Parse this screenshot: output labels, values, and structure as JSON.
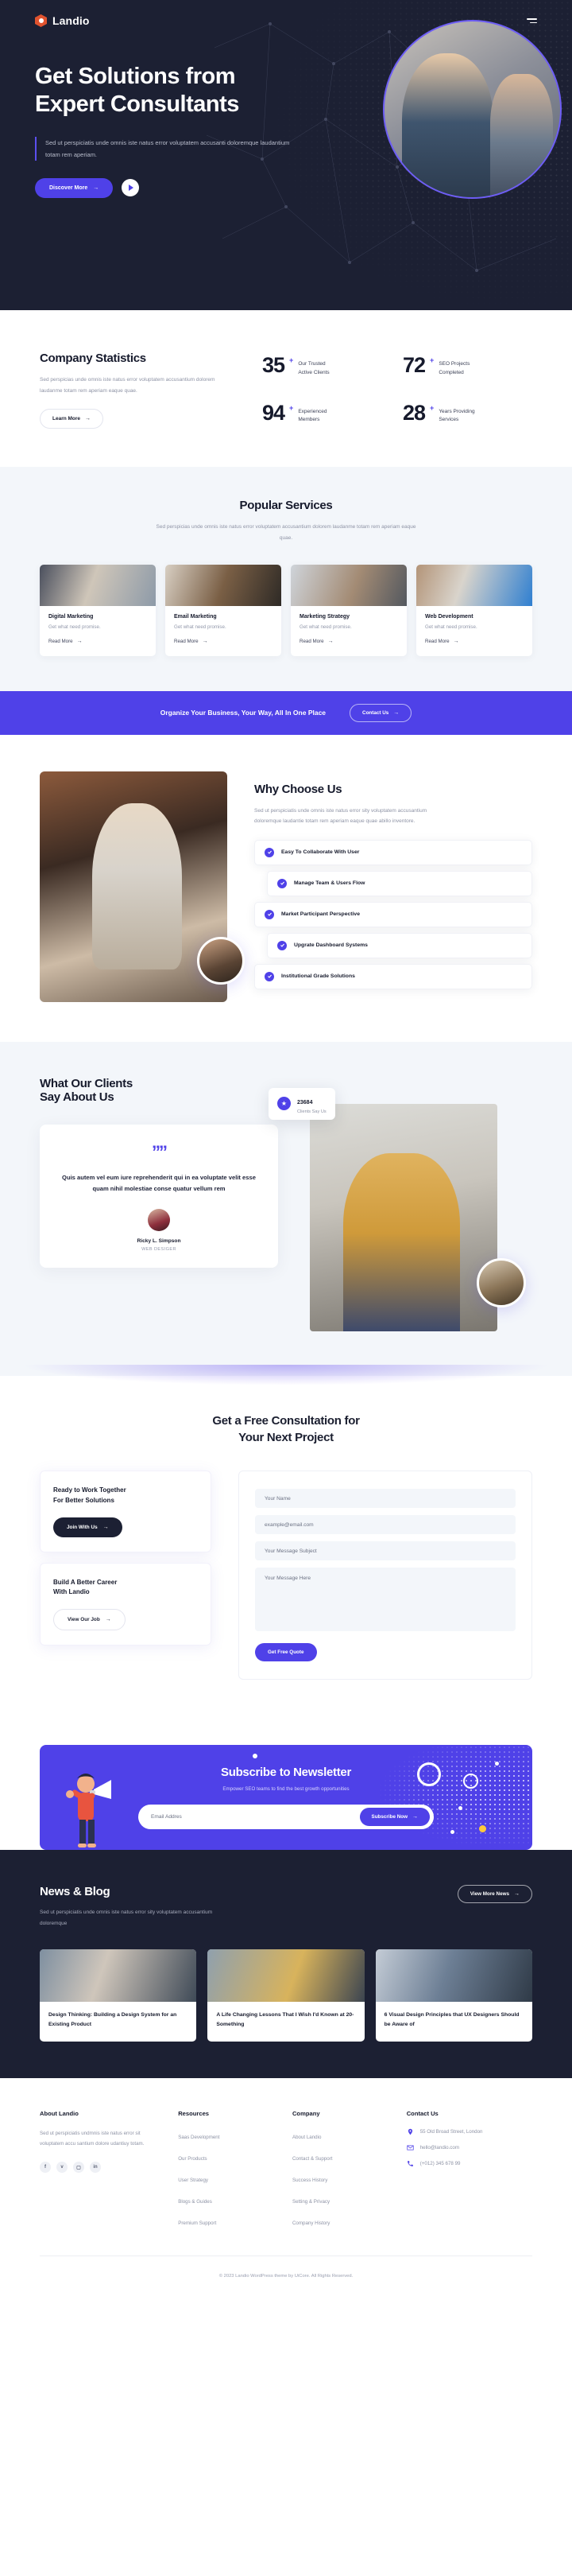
{
  "brand": {
    "name": "Landio",
    "logo_icon": "hexagon-logo-icon",
    "menu_icon": "menu-icon"
  },
  "hero": {
    "title_line1": "Get Solutions from",
    "title_line2": "Expert Consultants",
    "paragraph": "Sed ut perspiciatis unde omnis iste natus error voluptatem accusanti doloremque laudantium totam rem aperiam.",
    "primary_button": "Discover More",
    "play_icon": "play-icon"
  },
  "stats": {
    "title": "Company Statistics",
    "paragraph": "Sed perspicias unde omnis iste natus error voluptatem accusantium dolorem laudanme totam rem aperiam eaque quae.",
    "button": "Learn More",
    "items": [
      {
        "value": "35",
        "suffix": "+",
        "label_line1": "Our Trusted",
        "label_line2": "Active Clients"
      },
      {
        "value": "72",
        "suffix": "+",
        "label_line1": "SEO Projects",
        "label_line2": "Completed"
      },
      {
        "value": "94",
        "suffix": "+",
        "label_line1": "Experienced",
        "label_line2": "Members"
      },
      {
        "value": "28",
        "suffix": "+",
        "label_line1": "Years Providing",
        "label_line2": "Services"
      }
    ]
  },
  "services": {
    "title": "Popular Services",
    "paragraph": "Sed perspicias unde omnis iste natus error voluptatem accusantium dolorem laudanme totam rem aperiam eaque quae.",
    "cards": [
      {
        "title": "Digital Marketing",
        "desc": "Get what need promise.",
        "link": "Read More"
      },
      {
        "title": "Email Marketing",
        "desc": "Get what need promise.",
        "link": "Read More"
      },
      {
        "title": "Marketing Strategy",
        "desc": "Get what need promise.",
        "link": "Read More"
      },
      {
        "title": "Web Development",
        "desc": "Get what need promise.",
        "link": "Read More"
      }
    ]
  },
  "cta_bar": {
    "text": "Organize Your Business, Your Way, All In One Place",
    "button": "Contact Us"
  },
  "why": {
    "title": "Why Choose Us",
    "paragraph": "Sed ut perspiciatis unde omnis iste natus error sity voluptatem accusantium doloremque laudantie totam rem aperiam eaque quae abillo inventore.",
    "features": [
      "Easy To Collaborate With User",
      "Manage Team & Users Flow",
      "Market Participant Perspective",
      "Upgrate Dashboard Systems",
      "Institutional Grade Solutions"
    ]
  },
  "testimonials": {
    "title_line1": "What Our Clients",
    "title_line2": "Say About Us",
    "quote_icon": "quote-icon",
    "quote": "Quis autem vel eum iure reprehenderit qui in ea voluptate velit esse quam nihil molestiae conse quatur vellum rem",
    "author": "Ricky L. Simpson",
    "role": "WEB DESIGER",
    "chip": {
      "count": "23684",
      "label": "Clients Say Us",
      "icon": "star-badge-icon"
    }
  },
  "consult": {
    "title_line1": "Get a Free Consultation for",
    "title_line2": "Your Next Project",
    "box1": {
      "title_line1": "Ready to Work Together",
      "title_line2": "For Better Solutions",
      "button": "Join With Us"
    },
    "box2": {
      "title_line1": "Build A Better Career",
      "title_line2": "With Landio",
      "button": "View Our Job"
    },
    "form": {
      "name_placeholder": "Your Name",
      "email_placeholder": "example@email.com",
      "subject_placeholder": "Your Message Subject",
      "message_placeholder": "Your Message Here",
      "submit": "Get Free Quote"
    }
  },
  "newsletter": {
    "title": "Subscribe to Newsletter",
    "subtitle": "Empower SEO teams to find the best growth opportunities",
    "input_placeholder": "Email Addres",
    "button": "Subscribe Now"
  },
  "blog": {
    "title": "News & Blog",
    "paragraph": "Sed ut perspiciatis unde omnis iste natus error sity voluptatem accusantium doloremque",
    "button": "View More News",
    "posts": [
      {
        "title": "Design Thinking: Building a Design System for an Existing Product"
      },
      {
        "title": "A Life Changing Lessons That I Wish I'd Known at 20-Something"
      },
      {
        "title": "6 Visual Design Principles that UX Designers Should be Aware of"
      }
    ]
  },
  "footer": {
    "about": {
      "heading": "About Landio",
      "paragraph": "Sed ut perspiciatis undmnis iste natus error sit voluptatem accu santium dolore udantiuy totam.",
      "socials": [
        {
          "name": "facebook-icon",
          "glyph": "f"
        },
        {
          "name": "twitter-icon",
          "glyph": "ᴠ"
        },
        {
          "name": "instagram-icon",
          "glyph": "▢"
        },
        {
          "name": "linkedin-icon",
          "glyph": "in"
        }
      ]
    },
    "resources": {
      "heading": "Resources",
      "links": [
        "Saas Development",
        "Our Products",
        "User Strategy",
        "Blogs & Guides",
        "Premium Support"
      ]
    },
    "company": {
      "heading": "Company",
      "links": [
        "About Landio",
        "Contact & Support",
        "Success History",
        "Setting & Privacy",
        "Company History"
      ]
    },
    "contact": {
      "heading": "Contact Us",
      "items": [
        {
          "icon": "location-pin-icon",
          "text": "55 Old Broad Street, London"
        },
        {
          "icon": "envelope-icon",
          "text": "hello@landio.com"
        },
        {
          "icon": "phone-icon",
          "text": "(+012) 345 678 99"
        }
      ]
    },
    "copyright": "© 2023 Landio WordPress theme by UiCore. All Rights Reserved."
  },
  "colors": {
    "accent": "#4f41e8",
    "dark": "#1c2033",
    "light": "#f3f6fa",
    "logo": "#e0532f"
  }
}
